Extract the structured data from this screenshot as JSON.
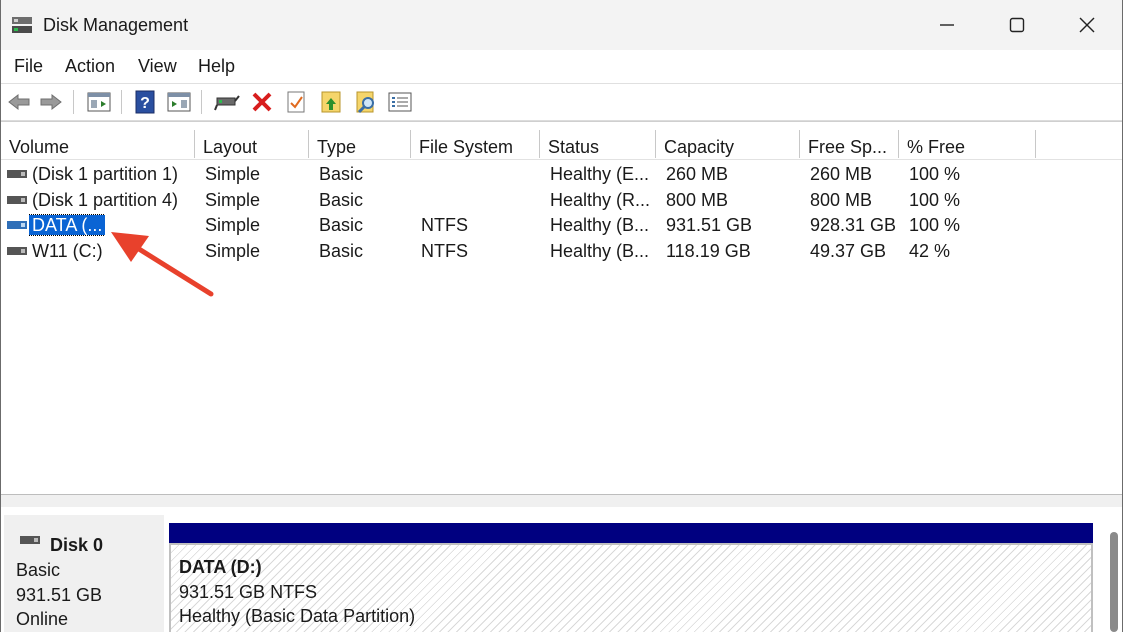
{
  "window": {
    "title": "Disk Management",
    "icons": {
      "app": "disk-management-icon",
      "minimize": "minimize-icon",
      "maximize": "maximize-icon",
      "close": "close-icon"
    }
  },
  "menu": {
    "file": "File",
    "action": "Action",
    "view": "View",
    "help": "Help"
  },
  "toolbar": {
    "icons": [
      "back-arrow-icon",
      "forward-arrow-icon",
      "console-tree-icon",
      "help-icon",
      "action-pane-icon",
      "connect-disk-icon",
      "delete-icon",
      "properties-icon",
      "up-folder-icon",
      "search-folder-icon",
      "list-view-icon"
    ]
  },
  "table": {
    "columns": [
      "Volume",
      "Layout",
      "Type",
      "File System",
      "Status",
      "Capacity",
      "Free Sp...",
      "% Free"
    ],
    "rows": [
      {
        "volume": "(Disk 1 partition 1)",
        "layout": "Simple",
        "type": "Basic",
        "fs": "",
        "status": "Healthy (E...",
        "capacity": "260 MB",
        "free": "260 MB",
        "pct": "100 %"
      },
      {
        "volume": "(Disk 1 partition 4)",
        "layout": "Simple",
        "type": "Basic",
        "fs": "",
        "status": "Healthy (R...",
        "capacity": "800 MB",
        "free": "800 MB",
        "pct": "100 %"
      },
      {
        "volume": "DATA (...",
        "layout": "Simple",
        "type": "Basic",
        "fs": "NTFS",
        "status": "Healthy (B...",
        "capacity": "931.51 GB",
        "free": "928.31 GB",
        "pct": "100 %"
      },
      {
        "volume": "W11 (C:)",
        "layout": "Simple",
        "type": "Basic",
        "fs": "NTFS",
        "status": "Healthy (B...",
        "capacity": "118.19 GB",
        "free": "49.37 GB",
        "pct": "42 %"
      }
    ],
    "selected_row": 2
  },
  "annotation": {
    "color": "#e8412c"
  },
  "disk0": {
    "name": "Disk 0",
    "type": "Basic",
    "size": "931.51 GB",
    "state": "Online",
    "partition": {
      "label": "DATA  (D:)",
      "size_fs": "931.51 GB NTFS",
      "health": "Healthy (Basic Data Partition)",
      "header_color": "#000080"
    }
  },
  "colors": {
    "selection": "#0a64d4",
    "titlebar": "#f3f3f3"
  }
}
